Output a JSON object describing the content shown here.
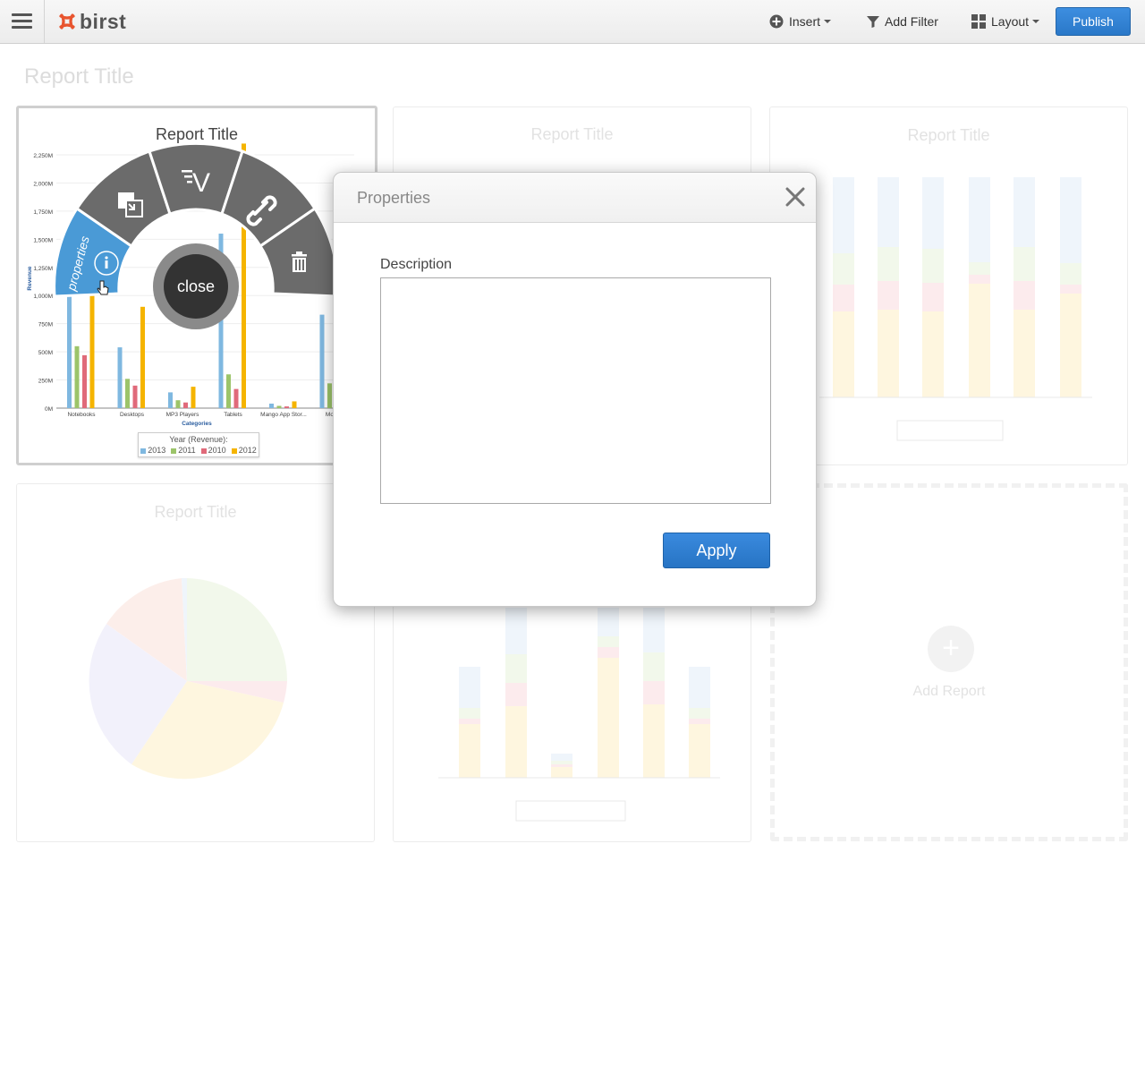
{
  "app": {
    "logo": "birst"
  },
  "toolbar": {
    "insert_label": "Insert",
    "add_filter_label": "Add Filter",
    "layout_label": "Layout",
    "publish_label": "Publish"
  },
  "page": {
    "title": "Report Title"
  },
  "cards": {
    "card1_title": "Report Title",
    "card2_title": "Report Title",
    "card3_title": "Report Title",
    "card4_title": "Report Title",
    "add_report_label": "Add Report"
  },
  "radial_menu": {
    "properties_label": "properties",
    "close_label": "close"
  },
  "modal": {
    "title": "Properties",
    "description_label": "Description",
    "description_value": "",
    "apply_label": "Apply"
  },
  "colors": {
    "accent": "#2a78c8",
    "menu_active": "#4a9ad6",
    "menu_segment": "#6b6b6b",
    "s2013": "#7fb8e0",
    "s2011": "#9cc46a",
    "s2010": "#e06a7a",
    "s2012": "#f5b400"
  },
  "chart_data": [
    {
      "type": "bar",
      "title": "Report Title",
      "xlabel": "Categories",
      "ylabel": "Revenue",
      "categories": [
        "Notebooks",
        "Desktops",
        "MP3 Players",
        "Tablets",
        "Mango App Stor...",
        "Mobile"
      ],
      "yticks": [
        "0M",
        "250M",
        "500M",
        "750M",
        "1,000M",
        "1,250M",
        "1,500M",
        "1,750M",
        "2,000M",
        "2,250M"
      ],
      "ylim": [
        0,
        2250
      ],
      "legend_title": "Year (Revenue):",
      "series": [
        {
          "name": "2013",
          "values": [
            1050,
            540,
            140,
            1550,
            40,
            830
          ]
        },
        {
          "name": "2011",
          "values": [
            550,
            260,
            70,
            300,
            20,
            220
          ]
        },
        {
          "name": "2010",
          "values": [
            470,
            200,
            50,
            170,
            15,
            0
          ]
        },
        {
          "name": "2012",
          "values": [
            1040,
            900,
            190,
            2350,
            60,
            0
          ]
        }
      ]
    }
  ]
}
